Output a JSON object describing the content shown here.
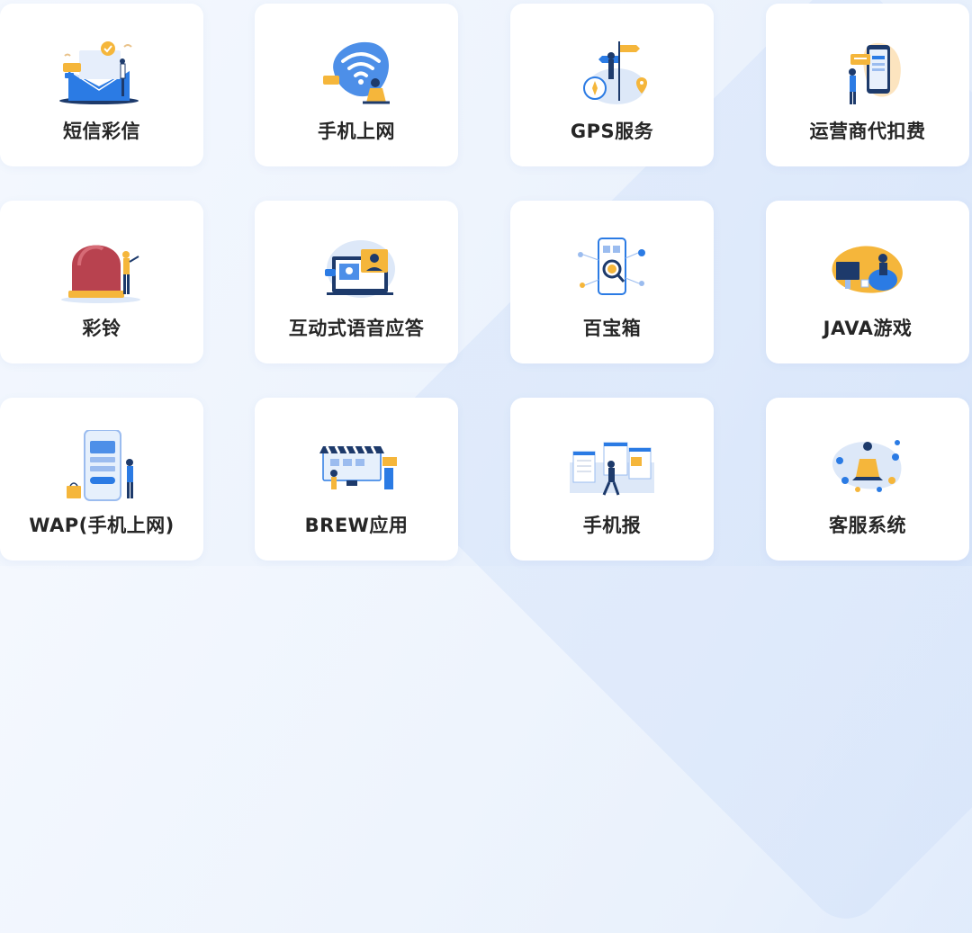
{
  "services": [
    {
      "label": "短信彩信",
      "icon": "sms-mms-icon"
    },
    {
      "label": "手机上网",
      "icon": "mobile-internet-icon"
    },
    {
      "label": "GPS服务",
      "icon": "gps-service-icon"
    },
    {
      "label": "运营商代扣费",
      "icon": "carrier-billing-icon"
    },
    {
      "label": "彩铃",
      "icon": "ringback-tone-icon"
    },
    {
      "label": "互动式语音应答",
      "icon": "ivr-icon"
    },
    {
      "label": "百宝箱",
      "icon": "treasure-box-icon"
    },
    {
      "label": "JAVA游戏",
      "icon": "java-game-icon"
    },
    {
      "label": "WAP(手机上网)",
      "icon": "wap-icon"
    },
    {
      "label": "BREW应用",
      "icon": "brew-app-icon"
    },
    {
      "label": "手机报",
      "icon": "mobile-newspaper-icon"
    },
    {
      "label": "客服系统",
      "icon": "customer-service-icon"
    }
  ],
  "colors": {
    "accent_blue": "#2b7be4",
    "accent_orange": "#f5b63b",
    "dark_navy": "#1d3a6b",
    "text": "#262626",
    "card_bg": "#ffffff"
  }
}
